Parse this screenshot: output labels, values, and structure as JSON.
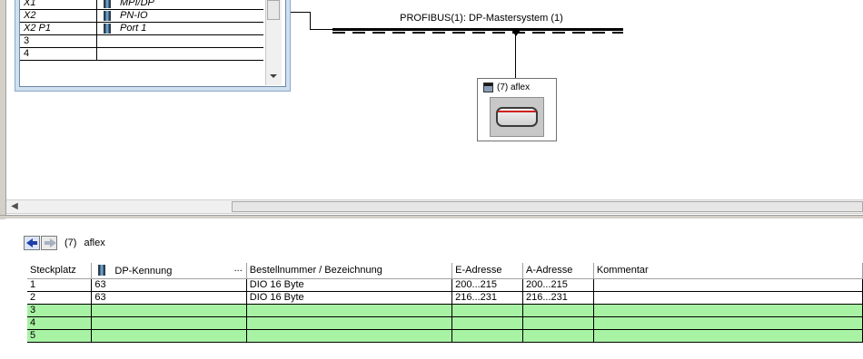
{
  "rack": {
    "rows": [
      {
        "slot": "X1",
        "module": "MPI/DP"
      },
      {
        "slot": "X2",
        "module": "PN-IO"
      },
      {
        "slot": "X2 P1",
        "module": "Port 1"
      },
      {
        "slot": "3",
        "module": ""
      },
      {
        "slot": "4",
        "module": ""
      }
    ]
  },
  "network": {
    "bus_label": "PROFIBUS(1): DP-Mastersystem (1)",
    "device_label": "(7) aflex"
  },
  "detail": {
    "nav_number": "(7)",
    "nav_name": "aflex",
    "columns": [
      "Steckplatz",
      "DP-Kennung",
      "...",
      "Bestellnummer / Bezeichnung",
      "E-Adresse",
      "A-Adresse",
      "Kommentar"
    ],
    "rows": [
      {
        "slot": "1",
        "dp": "63",
        "order": "DIO 16 Byte",
        "e_addr": "200...215",
        "a_addr": "200...215",
        "comment": ""
      },
      {
        "slot": "2",
        "dp": "63",
        "order": "DIO 16 Byte",
        "e_addr": "216...231",
        "a_addr": "216...231",
        "comment": ""
      },
      {
        "slot": "3",
        "dp": "",
        "order": "",
        "e_addr": "",
        "a_addr": "",
        "comment": ""
      },
      {
        "slot": "4",
        "dp": "",
        "order": "",
        "e_addr": "",
        "a_addr": "",
        "comment": ""
      },
      {
        "slot": "5",
        "dp": "",
        "order": "",
        "e_addr": "",
        "a_addr": "",
        "comment": ""
      }
    ]
  },
  "colors": {
    "empty_slot": "#a8f2a4",
    "bus": "#000000",
    "rack_frame": "#cfe0f0"
  }
}
